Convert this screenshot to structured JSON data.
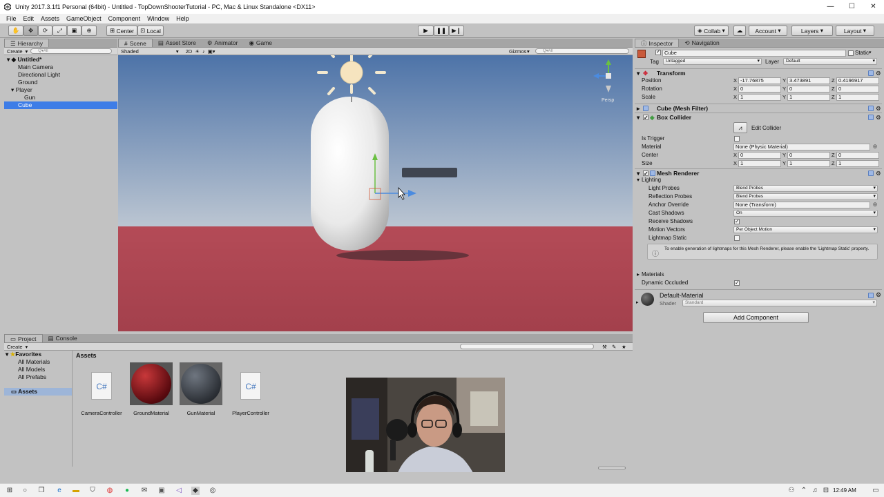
{
  "window": {
    "title": "Unity 2017.3.1f1 Personal (64bit) - Untitled - TopDownShooterTutorial - PC, Mac & Linux Standalone <DX11>"
  },
  "menu": [
    "File",
    "Edit",
    "Assets",
    "GameObject",
    "Component",
    "Window",
    "Help"
  ],
  "toolbar": {
    "pivot": "Center",
    "space": "Local",
    "collab": "Collab",
    "account": "Account",
    "layers": "Layers",
    "layout": "Layout"
  },
  "hierarchy": {
    "tab": "Hierarchy",
    "create": "Create",
    "search_placeholder": "Q▾All",
    "scene": "Untitled*",
    "items": [
      "Main Camera",
      "Directional Light",
      "Ground",
      "Player",
      "Gun",
      "Cube"
    ]
  },
  "scene": {
    "tabs": [
      "Scene",
      "Asset Store",
      "Animator",
      "Game"
    ],
    "shading": "Shaded",
    "mode2d": "2D",
    "gizmos": "Gizmos",
    "search_placeholder": "Q▾All",
    "persp": "Persp"
  },
  "inspector": {
    "tabs": [
      "Inspector",
      "Navigation"
    ],
    "object_name": "Cube",
    "static_label": "Static",
    "tag_label": "Tag",
    "tag": "Untagged",
    "layer_label": "Layer",
    "layer": "Default",
    "transform": {
      "title": "Transform",
      "position_label": "Position",
      "rotation_label": "Rotation",
      "scale_label": "Scale",
      "position": [
        "-17.76875",
        "3.473891",
        "0.4196917"
      ],
      "rotation": [
        "0",
        "0",
        "0"
      ],
      "scale": [
        "1",
        "1",
        "1"
      ]
    },
    "mesh_filter": "Cube (Mesh Filter)",
    "box_collider": {
      "title": "Box Collider",
      "edit_collider": "Edit Collider",
      "is_trigger_label": "Is Trigger",
      "material_label": "Material",
      "material": "None (Physic Material)",
      "center_label": "Center",
      "center": [
        "0",
        "0",
        "0"
      ],
      "size_label": "Size",
      "size": [
        "1",
        "1",
        "1"
      ]
    },
    "mesh_renderer": {
      "title": "Mesh Renderer",
      "lighting": "Lighting",
      "light_probes_label": "Light Probes",
      "light_probes": "Blend Probes",
      "reflection_probes_label": "Reflection Probes",
      "reflection_probes": "Blend Probes",
      "anchor_override_label": "Anchor Override",
      "anchor_override": "None (Transform)",
      "cast_shadows_label": "Cast Shadows",
      "cast_shadows": "On",
      "receive_shadows_label": "Receive Shadows",
      "motion_vectors_label": "Motion Vectors",
      "motion_vectors": "Per Object Motion",
      "lightmap_static_label": "Lightmap Static",
      "info": "To enable generation of lightmaps for this Mesh Renderer, please enable the 'Lightmap Static' property.",
      "materials_label": "Materials",
      "dynamic_occluded_label": "Dynamic Occluded"
    },
    "material": {
      "name": "Default-Material",
      "shader_label": "Shader",
      "shader": "Standard"
    },
    "add_component": "Add Component"
  },
  "project": {
    "tabs": [
      "Project",
      "Console"
    ],
    "create": "Create",
    "favorites": "Favorites",
    "fav_items": [
      "All Materials",
      "All Models",
      "All Prefabs"
    ],
    "assets_folder": "Assets",
    "breadcrumb": "Assets",
    "assets": [
      "CameraController",
      "GroundMaterial",
      "GunMaterial",
      "PlayerController"
    ]
  },
  "taskbar": {
    "time": "12:49 AM"
  }
}
